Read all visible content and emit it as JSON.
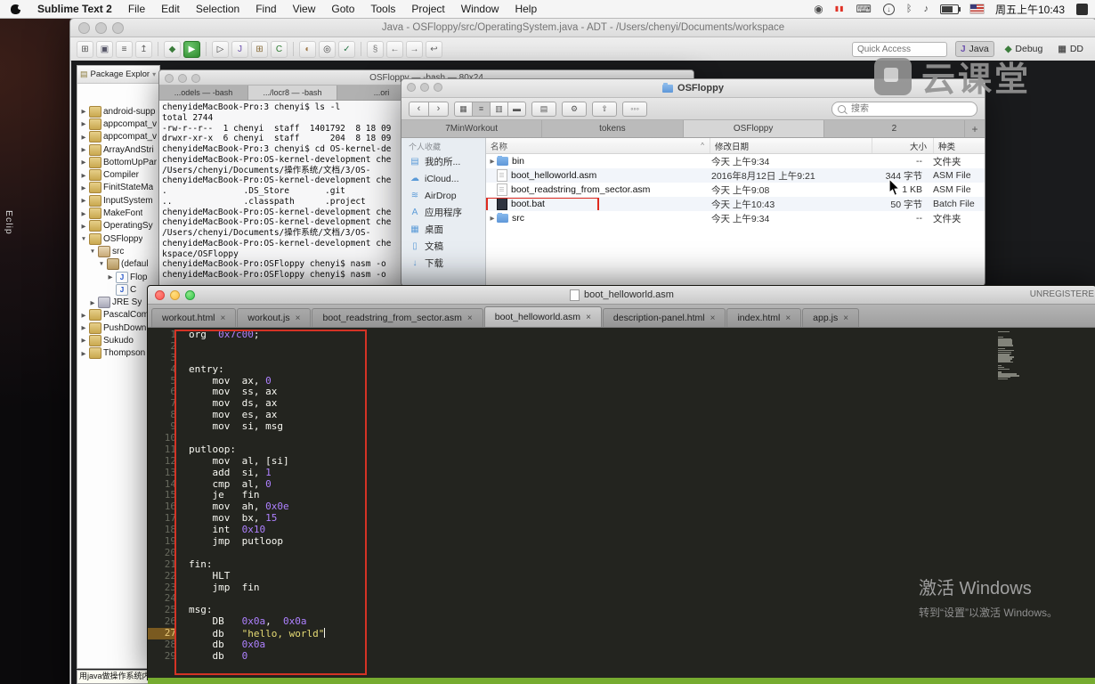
{
  "menu_bar": {
    "app_name": "Sublime Text 2",
    "menus": [
      "File",
      "Edit",
      "Selection",
      "Find",
      "View",
      "Goto",
      "Tools",
      "Project",
      "Window",
      "Help"
    ],
    "status_icons": [
      "record-icon",
      "pause-icon",
      "keyboard-icon",
      "download-icon",
      "bluetooth-icon",
      "volume-icon",
      "battery-icon",
      "flag-icon"
    ],
    "clock": "周五上午10:43"
  },
  "desktop": {
    "side_label": "Eclip"
  },
  "eclipse": {
    "window_title": "Java - OSFloppy/src/OperatingSystem.java - ADT - /Users/chenyi/Documents/workspace",
    "quick_access_placeholder": "Quick Access",
    "toolbar_icons": [
      "new-wizard-icon",
      "save-icon",
      "print-icon",
      "export-icon",
      "debug-icon",
      "run-icon",
      "external-tools-icon",
      "new-java-project-icon",
      "new-package-icon",
      "new-class-icon",
      "jar-icon",
      "search-icon",
      "task-icon",
      "annotation-icon",
      "back-icon",
      "forward-icon",
      "last-edit-icon"
    ],
    "perspectives": [
      {
        "label": "Java",
        "active": true
      },
      {
        "label": "Debug",
        "active": false
      },
      {
        "label": "DD",
        "active": false
      }
    ],
    "package_explorer": {
      "tab_label": "Package Explor",
      "tree": [
        {
          "label": "android-supp",
          "level": 0,
          "state": "collapsed",
          "icon": "project"
        },
        {
          "label": "appcompat_v",
          "level": 0,
          "state": "collapsed",
          "icon": "project"
        },
        {
          "label": "appcompat_v",
          "level": 0,
          "state": "collapsed",
          "icon": "project"
        },
        {
          "label": "ArrayAndStri",
          "level": 0,
          "state": "collapsed",
          "icon": "project"
        },
        {
          "label": "BottomUpPar",
          "level": 0,
          "state": "collapsed",
          "icon": "project"
        },
        {
          "label": "Compiler",
          "level": 0,
          "state": "collapsed",
          "icon": "project"
        },
        {
          "label": "FinitStateMa",
          "level": 0,
          "state": "collapsed",
          "icon": "project"
        },
        {
          "label": "InputSystem",
          "level": 0,
          "state": "collapsed",
          "icon": "project"
        },
        {
          "label": "MakeFont",
          "level": 0,
          "state": "collapsed",
          "icon": "project"
        },
        {
          "label": "OperatingSy",
          "level": 0,
          "state": "collapsed",
          "icon": "project"
        },
        {
          "label": "OSFloppy",
          "level": 0,
          "state": "expanded",
          "icon": "project"
        },
        {
          "label": "src",
          "level": 1,
          "state": "expanded",
          "icon": "src"
        },
        {
          "label": "(defaul",
          "level": 2,
          "state": "expanded",
          "icon": "package"
        },
        {
          "label": "Flop",
          "level": 3,
          "state": "collapsed",
          "icon": "java-file"
        },
        {
          "label": "C",
          "level": 3,
          "state": "none",
          "icon": "java-file"
        },
        {
          "label": "JRE Sy",
          "level": 1,
          "state": "collapsed",
          "icon": "library"
        },
        {
          "label": "PascalCom",
          "level": 0,
          "state": "collapsed",
          "icon": "project"
        },
        {
          "label": "PushDown",
          "level": 0,
          "state": "collapsed",
          "icon": "project"
        },
        {
          "label": "Sukudo",
          "level": 0,
          "state": "collapsed",
          "icon": "project"
        },
        {
          "label": "Thompson",
          "level": 0,
          "state": "collapsed",
          "icon": "project"
        }
      ]
    },
    "status_text": "用java做操作系统内核..."
  },
  "terminal": {
    "window_title": "OSFloppy — -bash — 80x24",
    "tabs": [
      {
        "label": "...odels — -bash",
        "active": false
      },
      {
        "label": ".../locr8 — -bash",
        "active": true
      },
      {
        "label": "...ori",
        "active": false
      }
    ],
    "lines": [
      "chenyideMacBook-Pro:3 chenyi$ ls -l",
      "total 2744",
      "-rw-r--r--  1 chenyi  staff  1401792  8 18 09",
      "drwxr-xr-x  6 chenyi  staff      204  8 18 09",
      "chenyideMacBook-Pro:3 chenyi$ cd OS-kernel-de",
      "chenyideMacBook-Pro:OS-kernel-development che",
      "/Users/chenyi/Documents/操作系统/文档/3/OS-",
      "chenyideMacBook-Pro:OS-kernel-development che",
      ".               .DS_Store       .git",
      "..              .classpath      .project",
      "chenyideMacBook-Pro:OS-kernel-development che",
      "chenyideMacBook-Pro:OS-kernel-development che",
      "/Users/chenyi/Documents/操作系统/文档/3/OS-",
      "chenyideMacBook-Pro:OS-kernel-development che",
      "kspace/OSFloppy",
      "chenyideMacBook-Pro:OSFloppy chenyi$ nasm -o",
      "chenyideMacBook-Pro:OSFloppy chenyi$ nasm -o"
    ]
  },
  "finder": {
    "window_title": "OSFloppy",
    "search_placeholder": "搜索",
    "tabs": [
      {
        "label": "7MinWorkout",
        "active": false
      },
      {
        "label": "tokens",
        "active": false
      },
      {
        "label": "OSFloppy",
        "active": true
      },
      {
        "label": "2",
        "active": false
      }
    ],
    "new_tab_label": "+",
    "sidebar": {
      "section": "个人收藏",
      "items": [
        {
          "label": "我的所...",
          "icon": "all-files-icon"
        },
        {
          "label": "iCloud...",
          "icon": "icloud-icon"
        },
        {
          "label": "AirDrop",
          "icon": "airdrop-icon"
        },
        {
          "label": "应用程序",
          "icon": "applications-icon"
        },
        {
          "label": "桌面",
          "icon": "desktop-icon"
        },
        {
          "label": "文稿",
          "icon": "documents-icon"
        },
        {
          "label": "下载",
          "icon": "downloads-icon"
        }
      ]
    },
    "columns": [
      "名称",
      "修改日期",
      "大小",
      "种类"
    ],
    "rows": [
      {
        "name": "bin",
        "date": "今天 上午9:34",
        "size": "--",
        "kind": "文件夹",
        "icon": "folder",
        "expandable": true,
        "annotated": false
      },
      {
        "name": "boot_helloworld.asm",
        "date": "2016年8月12日 上午9:21",
        "size": "344 字节",
        "kind": "ASM File",
        "icon": "file",
        "expandable": false,
        "annotated": false
      },
      {
        "name": "boot_readstring_from_sector.asm",
        "date": "今天 上午9:08",
        "size": "1 KB",
        "kind": "ASM File",
        "icon": "file",
        "expandable": false,
        "annotated": false
      },
      {
        "name": "boot.bat",
        "date": "今天 上午10:43",
        "size": "50 字节",
        "kind": "Batch File",
        "icon": "exec",
        "expandable": false,
        "annotated": true
      },
      {
        "name": "src",
        "date": "今天 上午9:34",
        "size": "--",
        "kind": "文件夹",
        "icon": "folder",
        "expandable": true,
        "annotated": false
      }
    ]
  },
  "sublime": {
    "window_title": "boot_helloworld.asm",
    "license_label": "UNREGISTERE",
    "tabs": [
      {
        "label": "workout.html",
        "active": false
      },
      {
        "label": "workout.js",
        "active": false
      },
      {
        "label": "boot_readstring_from_sector.asm",
        "active": false
      },
      {
        "label": "boot_helloworld.asm",
        "active": true
      },
      {
        "label": "description-panel.html",
        "active": false
      },
      {
        "label": "index.html",
        "active": false
      },
      {
        "label": "app.js",
        "active": false
      }
    ],
    "code_lines": [
      {
        "n": 1,
        "text": "org  0x7c00;"
      },
      {
        "n": 2,
        "text": ""
      },
      {
        "n": 3,
        "text": ""
      },
      {
        "n": 4,
        "text": "entry:"
      },
      {
        "n": 5,
        "text": "    mov  ax, 0"
      },
      {
        "n": 6,
        "text": "    mov  ss, ax"
      },
      {
        "n": 7,
        "text": "    mov  ds, ax"
      },
      {
        "n": 8,
        "text": "    mov  es, ax"
      },
      {
        "n": 9,
        "text": "    mov  si, msg"
      },
      {
        "n": 10,
        "text": ""
      },
      {
        "n": 11,
        "text": "putloop:"
      },
      {
        "n": 12,
        "text": "    mov  al, [si]"
      },
      {
        "n": 13,
        "text": "    add  si, 1"
      },
      {
        "n": 14,
        "text": "    cmp  al, 0"
      },
      {
        "n": 15,
        "text": "    je   fin"
      },
      {
        "n": 16,
        "text": "    mov  ah, 0x0e"
      },
      {
        "n": 17,
        "text": "    mov  bx, 15"
      },
      {
        "n": 18,
        "text": "    int  0x10"
      },
      {
        "n": 19,
        "text": "    jmp  putloop"
      },
      {
        "n": 20,
        "text": ""
      },
      {
        "n": 21,
        "text": "fin:"
      },
      {
        "n": 22,
        "text": "    HLT"
      },
      {
        "n": 23,
        "text": "    jmp  fin"
      },
      {
        "n": 24,
        "text": ""
      },
      {
        "n": 25,
        "text": "msg:"
      },
      {
        "n": 26,
        "text": "    DB   0x0a,  0x0a"
      },
      {
        "n": 27,
        "text": "    db   \"hello, world\"",
        "current": true
      },
      {
        "n": 28,
        "text": "    db   0x0a"
      },
      {
        "n": 29,
        "text": "    db   0"
      }
    ]
  },
  "watermarks": {
    "brand": "云课堂",
    "activate_line1": "激活 Windows",
    "activate_line2": "转到“设置”以激活 Windows。"
  },
  "colors": {
    "annotation_red": "#d43325",
    "editor_bg": "#23241f",
    "recording_strip_green": "#76ab30"
  }
}
